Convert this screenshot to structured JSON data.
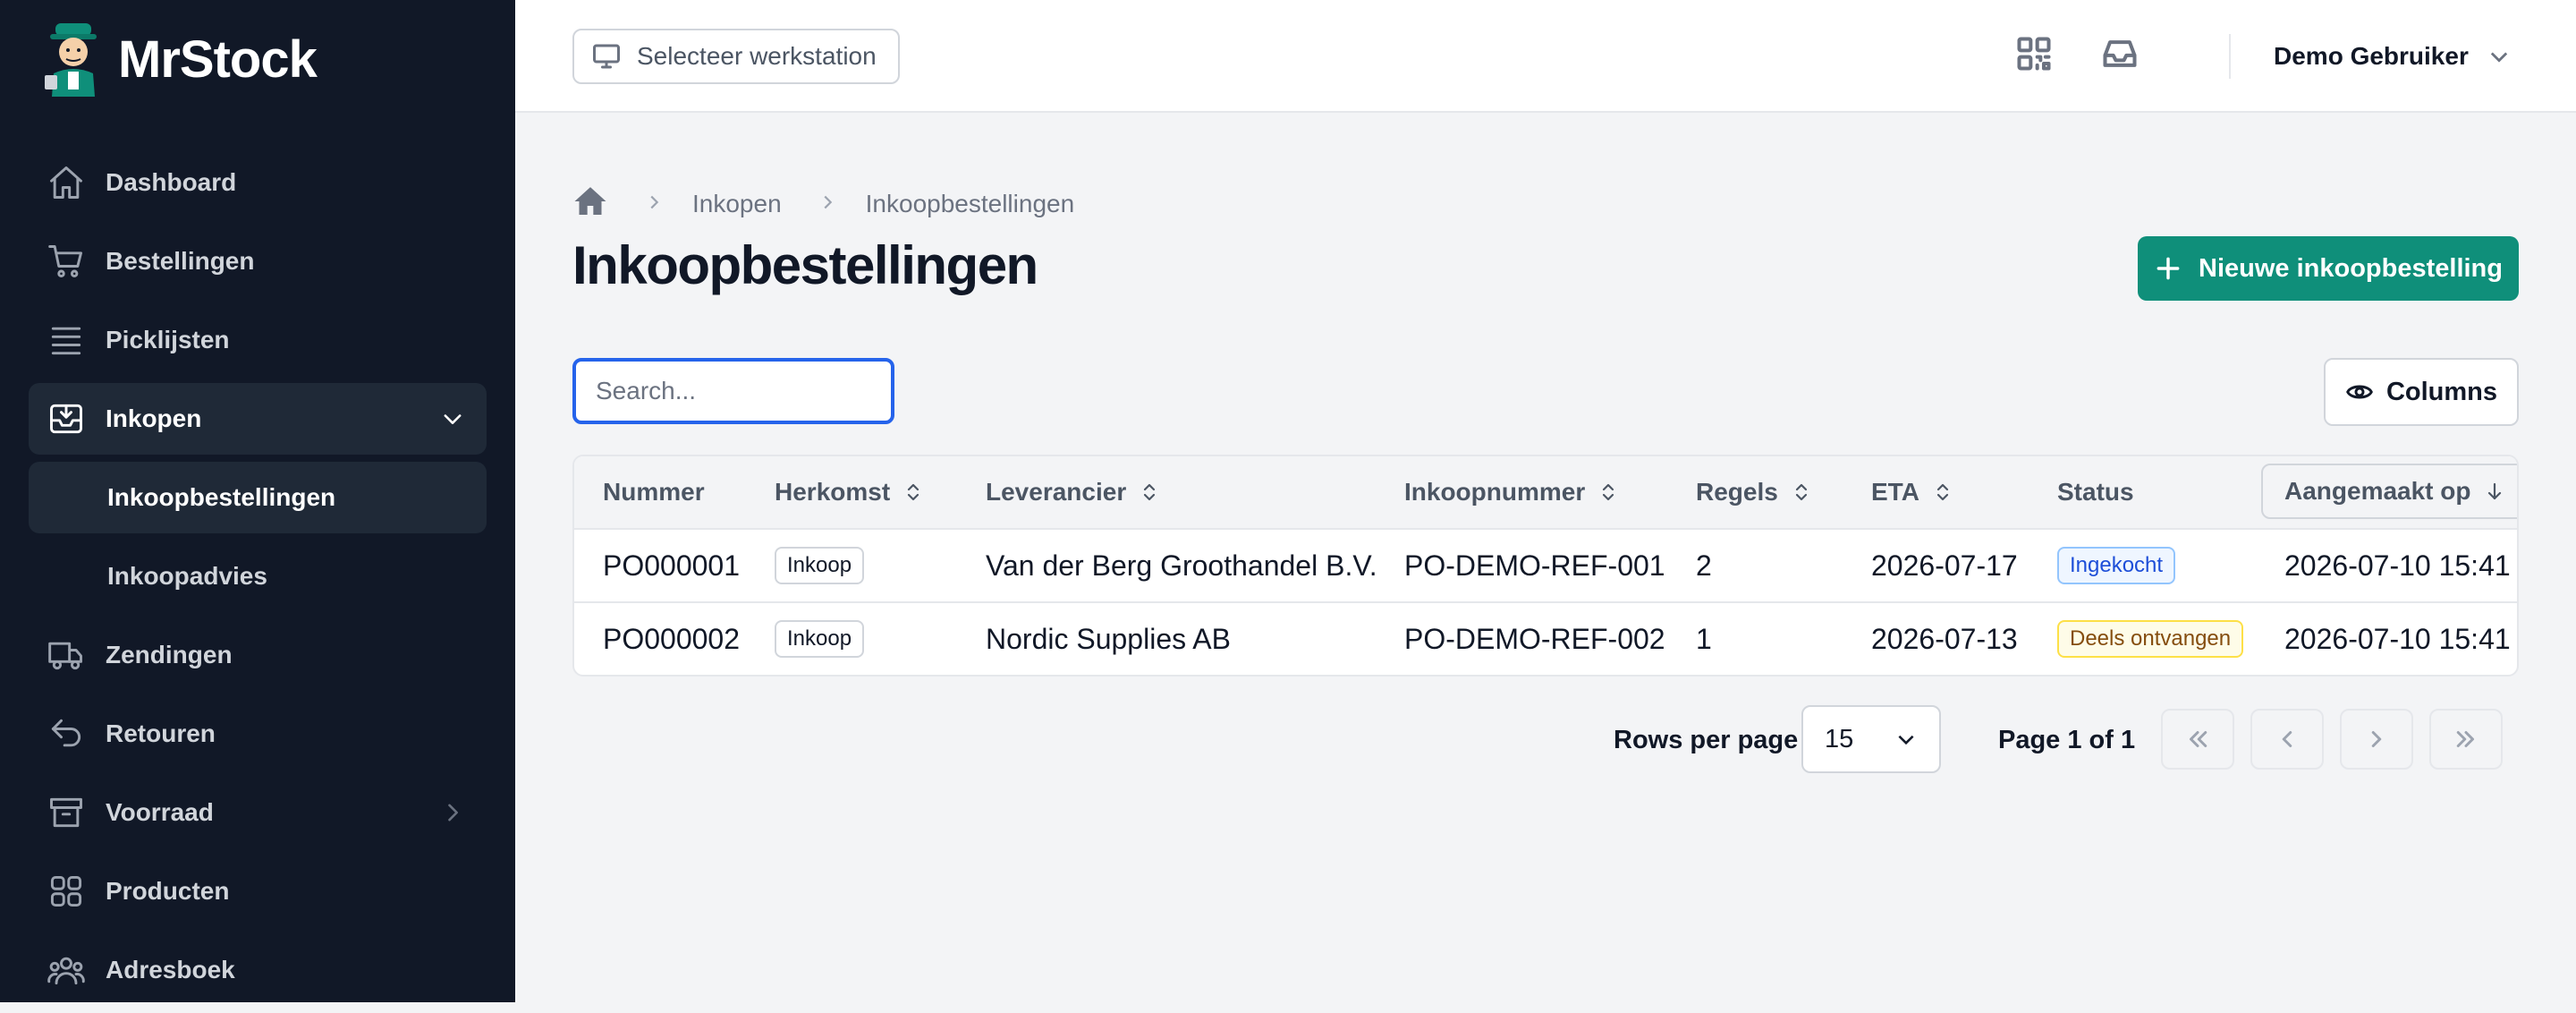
{
  "app": {
    "brand": "MrStock",
    "colors": {
      "sidebar_bg": "#111827",
      "accent": "#0f8f7a",
      "focus": "#2563eb"
    }
  },
  "sidebar": {
    "items": [
      {
        "label": "Dashboard",
        "icon": "home-icon"
      },
      {
        "label": "Bestellingen",
        "icon": "cart-icon"
      },
      {
        "label": "Picklijsten",
        "icon": "list-icon"
      },
      {
        "label": "Inkopen",
        "icon": "inbox-icon",
        "expanded": true
      },
      {
        "label": "Inkoopbestellingen",
        "sub": true,
        "active": true
      },
      {
        "label": "Inkoopadvies",
        "sub": true
      },
      {
        "label": "Zendingen",
        "icon": "truck-icon"
      },
      {
        "label": "Retouren",
        "icon": "return-icon"
      },
      {
        "label": "Voorraad",
        "icon": "archive-icon",
        "has_children": true
      },
      {
        "label": "Producten",
        "icon": "grid-icon"
      },
      {
        "label": "Adresboek",
        "icon": "users-icon"
      }
    ]
  },
  "topbar": {
    "workstation_label": "Selecteer werkstation",
    "user_name": "Demo Gebruiker"
  },
  "breadcrumb": {
    "items": [
      "Inkopen",
      "Inkoopbestellingen"
    ]
  },
  "page": {
    "title": "Inkoopbestellingen",
    "new_button_label": "Nieuwe inkoopbestelling",
    "search_placeholder": "Search...",
    "columns_button_label": "Columns"
  },
  "table": {
    "columns": [
      "Nummer",
      "Herkomst",
      "Leverancier",
      "Inkoopnummer",
      "Regels",
      "ETA",
      "Status",
      "Aangemaakt op"
    ],
    "sorted_column": "Aangemaakt op",
    "sort_direction": "desc",
    "rows": [
      {
        "nummer": "PO000001",
        "herkomst": "Inkoop",
        "leverancier": "Van der Berg Groothandel B.V.",
        "inkoopnummer": "PO-DEMO-REF-001",
        "regels": "2",
        "eta": "2026-07-17",
        "status": "Ingekocht",
        "status_color": "#1d4ed8",
        "aangemaakt_op": "2026-07-10 15:41"
      },
      {
        "nummer": "PO000002",
        "herkomst": "Inkoop",
        "leverancier": "Nordic Supplies AB",
        "inkoopnummer": "PO-DEMO-REF-002",
        "regels": "1",
        "eta": "2026-07-13",
        "status": "Deels ontvangen",
        "status_color": "#854d0e",
        "aangemaakt_op": "2026-07-10 15:41"
      }
    ]
  },
  "pagination": {
    "rows_per_page_label": "Rows per page",
    "rows_per_page_value": "15",
    "page_info": "Page 1 of 1"
  }
}
